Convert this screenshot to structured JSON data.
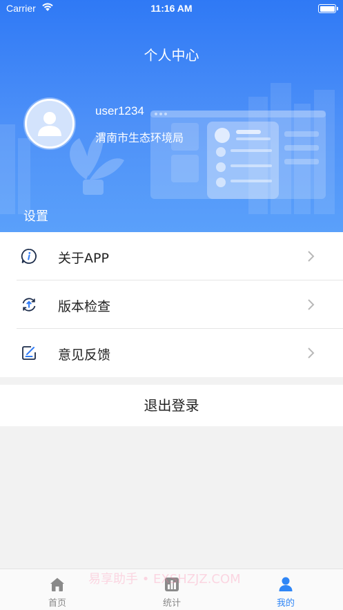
{
  "status_bar": {
    "carrier": "Carrier",
    "time": "11:16 AM"
  },
  "header": {
    "title": "个人中心"
  },
  "profile": {
    "username": "user1234",
    "organization": "渭南市生态环境局"
  },
  "settings": {
    "section_title": "设置",
    "items": [
      {
        "label": "关于APP",
        "icon": "info-icon"
      },
      {
        "label": "版本检查",
        "icon": "refresh-upload-icon"
      },
      {
        "label": "意见反馈",
        "icon": "feedback-edit-icon"
      }
    ]
  },
  "logout": {
    "label": "退出登录"
  },
  "tabbar": {
    "tabs": [
      {
        "label": "首页",
        "icon": "home-icon",
        "active": false
      },
      {
        "label": "统计",
        "icon": "bar-chart-icon",
        "active": false
      },
      {
        "label": "我的",
        "icon": "user-icon",
        "active": true
      }
    ]
  },
  "watermark": "易享助手 • EXSHZJZ.COM",
  "colors": {
    "accent": "#2f79f5",
    "active_tab": "#2f86f6",
    "background": "#f2f2f2"
  }
}
